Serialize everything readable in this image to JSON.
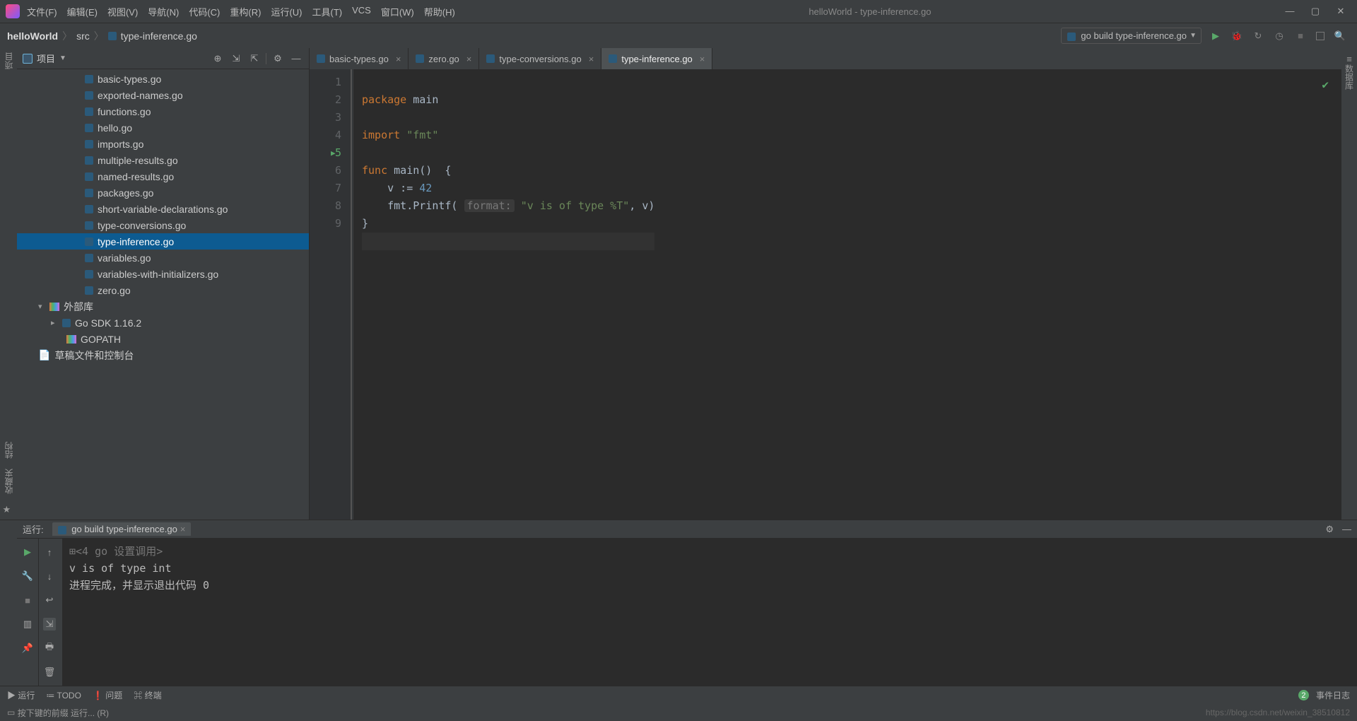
{
  "window": {
    "title": "helloWorld - type-inference.go",
    "menus": [
      "文件(F)",
      "编辑(E)",
      "视图(V)",
      "导航(N)",
      "代码(C)",
      "重构(R)",
      "运行(U)",
      "工具(T)",
      "VCS",
      "窗口(W)",
      "帮助(H)"
    ]
  },
  "breadcrumb": {
    "project": "helloWorld",
    "src": "src",
    "file": "type-inference.go"
  },
  "run_config": {
    "label": "go build type-inference.go"
  },
  "sidebar": {
    "label": "项目",
    "files": [
      "basic-types.go",
      "exported-names.go",
      "functions.go",
      "hello.go",
      "imports.go",
      "multiple-results.go",
      "named-results.go",
      "packages.go",
      "short-variable-declarations.go",
      "type-conversions.go",
      "type-inference.go",
      "variables.go",
      "variables-with-initializers.go",
      "zero.go"
    ],
    "selected": "type-inference.go",
    "ext_lib": "外部库",
    "go_sdk": "Go SDK 1.16.2",
    "gopath": "GOPATH <go>",
    "scratch": "草稿文件和控制台"
  },
  "tabs": [
    {
      "label": "basic-types.go",
      "active": false
    },
    {
      "label": "zero.go",
      "active": false
    },
    {
      "label": "type-conversions.go",
      "active": false
    },
    {
      "label": "type-inference.go",
      "active": true
    }
  ],
  "code": {
    "lines": [
      "1",
      "2",
      "3",
      "4",
      "5",
      "6",
      "7",
      "8",
      "9"
    ],
    "l1_kw": "package",
    "l1_id": "main",
    "l3_kw": "import",
    "l3_str": "\"fmt\"",
    "l5_kw": "func",
    "l5_name": "main",
    "l5_paren": "()  {",
    "l6": "    v := ",
    "l6_num": "42",
    "l7a": "    fmt.Printf( ",
    "l7_hint": "format:",
    "l7_str": " \"v is of type %T\"",
    "l7b": ", v)",
    "l8": "}"
  },
  "run": {
    "label": "运行:",
    "tab": "go build type-inference.go",
    "top": "<4 go 设置调用>",
    "out": "v is of type int",
    "exit": "进程完成，并显示退出代码 0"
  },
  "bottom": {
    "run": "运行",
    "todo": "TODO",
    "problems": "问题",
    "terminal": "终端",
    "events": "事件日志",
    "events_count": "2"
  },
  "status": {
    "left": "按下键的前缀 运行... (R)",
    "watermark": "https://blog.csdn.net/weixin_38510812"
  },
  "left_strip": {
    "project": "项目",
    "struct": "结构",
    "fav": "收藏夹"
  },
  "right_strip": {
    "label": "数据库"
  }
}
